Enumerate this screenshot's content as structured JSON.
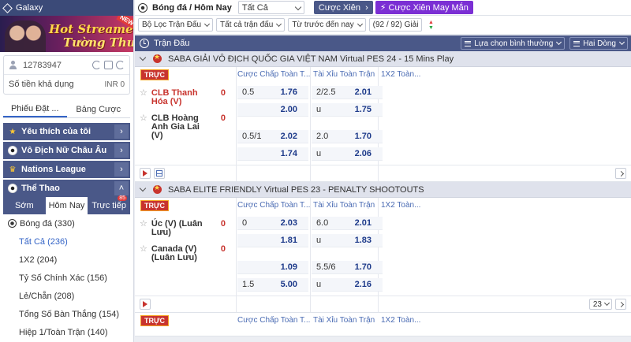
{
  "brand": {
    "name": "Galaxy"
  },
  "banner": {
    "line1": "Hot Streamer",
    "line2": "Tường Thuật",
    "badge": "NEW"
  },
  "account": {
    "id": "12783947",
    "balance_label": "Số tiền khả dụng",
    "balance_value": "INR 0"
  },
  "betslip_tabs": [
    "Phiếu Đặt ...",
    "Bảng Cược"
  ],
  "sidebar_sections": [
    {
      "label": "Yêu thích của tôi",
      "icon": "star-icon"
    },
    {
      "label": "Vô Địch Nữ Châu Âu",
      "icon": "soccer-ball-icon"
    },
    {
      "label": "Nations League",
      "icon": "trophy-icon"
    },
    {
      "label": "Thể Thao",
      "icon": "soccer-ball-icon"
    }
  ],
  "sport_tabs": {
    "items": [
      "Sớm",
      "Hôm Nay",
      "Trực tiếp"
    ],
    "badge": "85"
  },
  "sport": {
    "label": "Bóng đá",
    "count": "(330)"
  },
  "markets": [
    "Tất Cả (236)",
    "1X2 (204)",
    "Tỷ Số Chính Xác (156)",
    "Lẻ/Chẵn (208)",
    "Tổng Số Bàn Thắng (154)",
    "Hiệp 1/Toàn Trận (140)"
  ],
  "topbar": {
    "title": "Bóng đá / Hôm Nay",
    "select_value": "Tất Cả",
    "parlay": "Cược Xiên",
    "lucky_parlay": "Cược Xiên May Mắn"
  },
  "filters": {
    "items": [
      "Bộ Lọc Trận Đấu",
      "Tất cả trận đấu",
      "Từ trước đến nay"
    ],
    "count": "(92 / 92) Giải"
  },
  "section": {
    "title": "Trận Đấu",
    "sort": "Lựa chọn bình thường",
    "layout": "Hai Dòng"
  },
  "columns": [
    "Cược Chấp Toàn T...",
    "Tài Xỉu Toàn Trận",
    "1X2 Toàn..."
  ],
  "live_label": "TRỰC",
  "leagues": [
    {
      "name": "SABA GIẢI VÔ ĐỊCH QUỐC GIA VIỆT NAM Virtual PES 24 - 15 Mins Play",
      "home": "CLB Thanh Hóa (V)",
      "away": "CLB Hoàng Anh Gia Lai (V)",
      "home_score": "0",
      "away_score": "0",
      "rows": [
        [
          "0.5",
          "1.76",
          "2/2.5",
          "2.01"
        ],
        [
          "",
          "2.00",
          "u",
          "1.75"
        ],
        [
          "0.5/1",
          "2.02",
          "2.0",
          "1.70"
        ],
        [
          "",
          "1.74",
          "u",
          "2.06"
        ]
      ]
    },
    {
      "name": "SABA ELITE FRIENDLY Virtual PES 23 - PENALTY SHOOTOUTS",
      "home": "Úc (V) (Luân Lưu)",
      "away": "Canada (V) (Luân Lưu)",
      "home_score": "0",
      "away_score": "0",
      "rows": [
        [
          "0",
          "2.03",
          "6.0",
          "2.01"
        ],
        [
          "",
          "1.81",
          "u",
          "1.83"
        ],
        [
          "",
          "1.09",
          "5.5/6",
          "1.70"
        ],
        [
          "1.5",
          "5.00",
          "u",
          "2.16"
        ]
      ],
      "more": "23"
    }
  ],
  "third_columns": [
    "Cược Chấp Toàn T...",
    "Tài Xỉu Toàn Trận",
    "1X2 Toàn..."
  ]
}
